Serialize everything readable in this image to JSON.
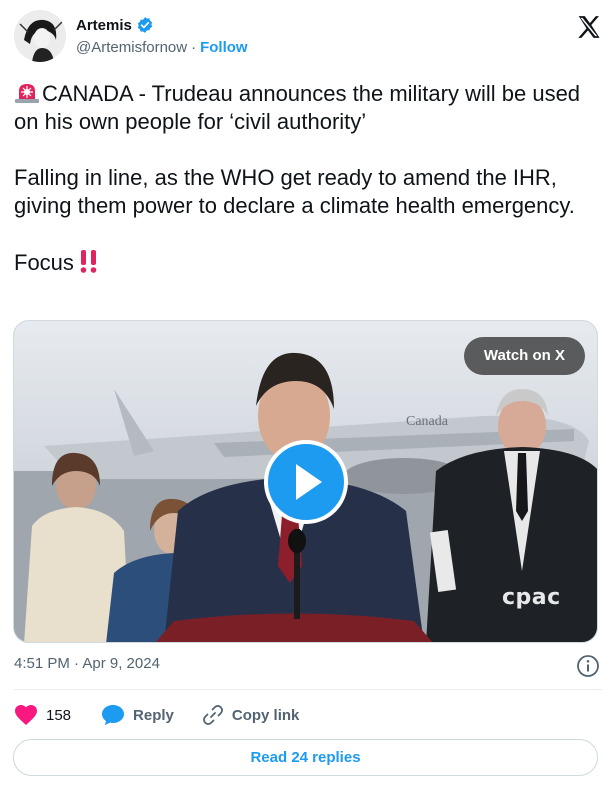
{
  "author": {
    "display_name": "Artemis",
    "handle": "@Artemisfornow",
    "separator": "·",
    "follow_label": "Follow",
    "verified_color": "#1d9bf0"
  },
  "tweet": {
    "line1": "CANADA - Trudeau announces the military will be used on his own people for ‘civil authority’",
    "line2": "Falling in line, as the WHO get ready to amend the IHR, giving them power to declare a climate health emergency.",
    "line3": "Focus",
    "emojis": [
      "rotating-light-emoji",
      "double-exclamation-emoji"
    ]
  },
  "media": {
    "watch_label": "Watch on X",
    "watermark": "cpac",
    "plane_text": "Canada",
    "play_color": "#1d9bf0"
  },
  "meta": {
    "timestamp": "4:51 PM · Apr 9, 2024"
  },
  "actions": {
    "like_count": "158",
    "reply_label": "Reply",
    "copy_label": "Copy link"
  },
  "footer": {
    "read_replies_label": "Read 24 replies"
  },
  "colors": {
    "like": "#f91880",
    "reply": "#1d9bf0",
    "link": "#1d9bf0",
    "muted": "#536471"
  }
}
